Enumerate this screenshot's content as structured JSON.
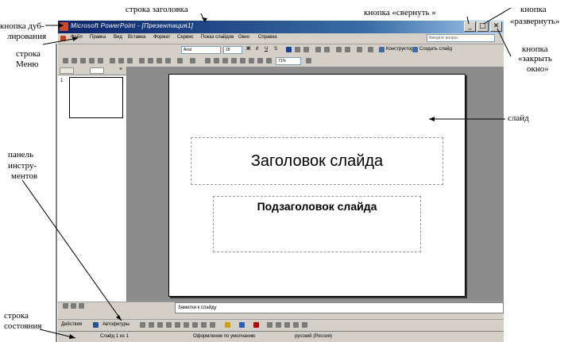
{
  "annotations": {
    "title_bar": "строка заголовка",
    "dup_button_line1": "кнопка дуб-",
    "dup_button_line2": "лирования",
    "minimize_button": "кнопка «свернуть »",
    "maximize_line1": "кнопка",
    "maximize_line2": "«развернуть»",
    "close_line1": "кнопка",
    "close_line2": "«закрыть",
    "close_line3": "окно»",
    "menu_line1": "строка",
    "menu_line2": "Меню",
    "slide": "слайд",
    "toolbar_line1": "панель",
    "toolbar_line2": "инстру-",
    "toolbar_line3": "ментов",
    "status_line1": "строка",
    "status_line2": "состояния"
  },
  "window": {
    "title": "Microsoft PowerPoint - [Презентация1]",
    "minimize_glyph": "_",
    "maximize_glyph": "□",
    "close_glyph": "✕"
  },
  "menu": {
    "items": [
      "Файл",
      "Правка",
      "Вид",
      "Вставка",
      "Формат",
      "Сервис",
      "Показ слайдов",
      "Окно",
      "Справка"
    ],
    "search_placeholder": "Введите вопрос"
  },
  "toolbar": {
    "font": "Arial",
    "font_size": "18",
    "zoom": "71%",
    "bold": "Ж",
    "italic": "К",
    "underline": "Ч",
    "shadow": "S",
    "designer": "Конструктор",
    "new_slide": "Создать слайд"
  },
  "slide": {
    "title": "Заголовок слайда",
    "subtitle": "Подзаголовок слайда",
    "thumb_number": "1"
  },
  "notes": {
    "text": "Заметки к слайду"
  },
  "drawing": {
    "actions": "Действия",
    "autoshapes": "Автофигуры"
  },
  "status": {
    "slide": "Слайд 1 из 1",
    "design": "Оформление по умолчанию",
    "language": "русский (Россия)"
  },
  "colors": {
    "titlebar_start": "#0a246a",
    "titlebar_end": "#a6caf0",
    "chrome": "#d4d0c8",
    "workarea": "#8c8c8c"
  }
}
